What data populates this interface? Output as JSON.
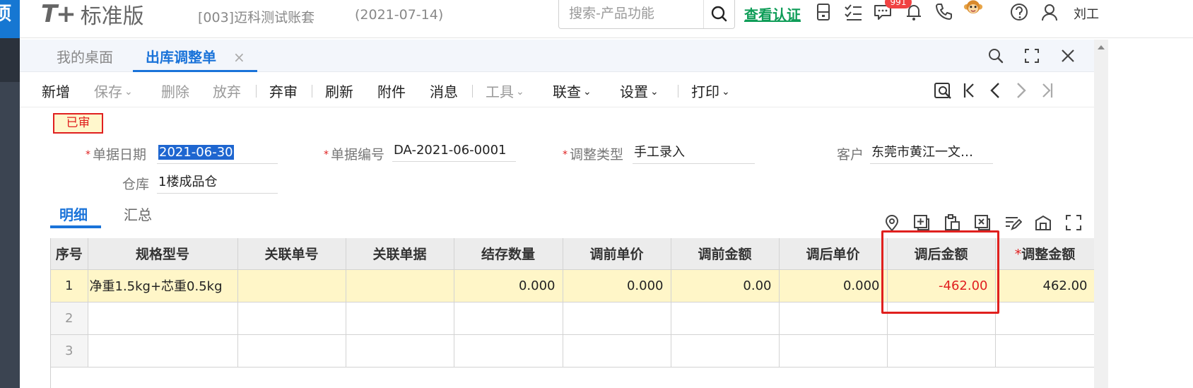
{
  "header": {
    "left_glyph": "项",
    "logo_mark": "T+",
    "logo_text": "标准版",
    "account": "[003]迈科测试账套",
    "account_date": "(2021-07-14)",
    "search_placeholder": "搜索-产品功能",
    "verify_link": "查看认证",
    "badge": "991",
    "user": "刘工"
  },
  "tabs": {
    "desk": "我的桌面",
    "doc": "出库调整单",
    "close": "×"
  },
  "toolbar": {
    "add": "新增",
    "save": "保存",
    "delete": "删除",
    "abandon": "放弃",
    "unaudit": "弃审",
    "refresh": "刷新",
    "attach": "附件",
    "message": "消息",
    "tools": "工具",
    "linked_query": "联查",
    "settings": "设置",
    "print": "打印",
    "dropdown_glyph": "⌄"
  },
  "form": {
    "status": "已审",
    "required_mark": "*",
    "date_label": "单据日期",
    "date_value": "2021-06-30",
    "number_label": "单据编号",
    "number_value": "DA-2021-06-0001",
    "type_label": "调整类型",
    "type_value": "手工录入",
    "customer_label": "客户",
    "customer_value": "东莞市黄江一文…",
    "warehouse_label": "仓库",
    "warehouse_value": "1楼成品仓"
  },
  "subtabs": {
    "detail": "明细",
    "summary": "汇总"
  },
  "grid": {
    "columns": [
      "序号",
      "规格型号",
      "关联单号",
      "关联单据",
      "结存数量",
      "调前单价",
      "调前金额",
      "调后单价",
      "调后金额",
      "调整金额"
    ],
    "required_mark": "*",
    "rows": [
      {
        "seq": "1",
        "spec": "净重1.5kg+芯重0.5kg",
        "ref_no": "",
        "ref_doc": "",
        "qty": "0.000",
        "pre_price": "0.000",
        "pre_amount": "0.00",
        "post_price": "0.000",
        "post_amount": "-462.00",
        "adj_amount": "462.00"
      },
      {
        "seq": "2"
      },
      {
        "seq": "3"
      }
    ]
  },
  "colors": {
    "accent": "#1a73d9",
    "verify": "#0f9d58",
    "highlight": "#e0201e",
    "row_selected": "#fff6c8"
  }
}
